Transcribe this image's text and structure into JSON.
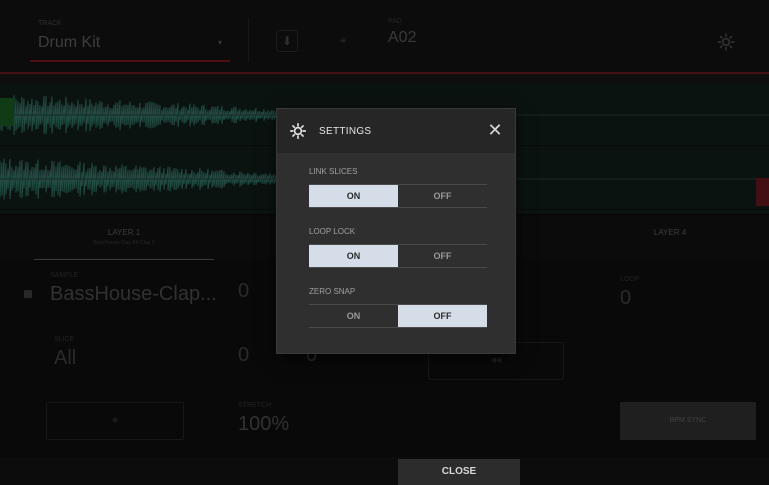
{
  "header": {
    "track_label": "TRACK",
    "track_value": "Drum Kit",
    "pad_label": "PAD",
    "pad_value": "A02"
  },
  "layers": [
    {
      "name": "LAYER 1",
      "sample": "BassHouse-Clap-Kit-Clap 2"
    },
    {
      "name": "LAYER 4",
      "sample": ""
    }
  ],
  "params": {
    "sample_label": "SAMPLE",
    "sample_value": "BassHouse-Clap...",
    "slice_label": "SLICE",
    "slice_value": "All",
    "semi_value": "0",
    "fine_value": "0",
    "tune_value": "0",
    "loop_label": "LOOP",
    "loop_value": "0",
    "stretch_label": "STRETCH",
    "stretch_value": "100%",
    "bpm_sync_label": "BPM SYNC"
  },
  "modal": {
    "title": "SETTINGS",
    "settings": [
      {
        "label": "LINK SLICES",
        "on_label": "ON",
        "off_label": "OFF",
        "selected": "ON"
      },
      {
        "label": "LOOP LOCK",
        "on_label": "ON",
        "off_label": "OFF",
        "selected": "ON"
      },
      {
        "label": "ZERO SNAP",
        "on_label": "ON",
        "off_label": "OFF",
        "selected": "OFF"
      }
    ]
  },
  "footer": {
    "close_label": "CLOSE"
  },
  "colors": {
    "accent_red": "#8a1c22",
    "toggle_selected": "#d4dde8",
    "waveform": "#3f8a7a"
  }
}
